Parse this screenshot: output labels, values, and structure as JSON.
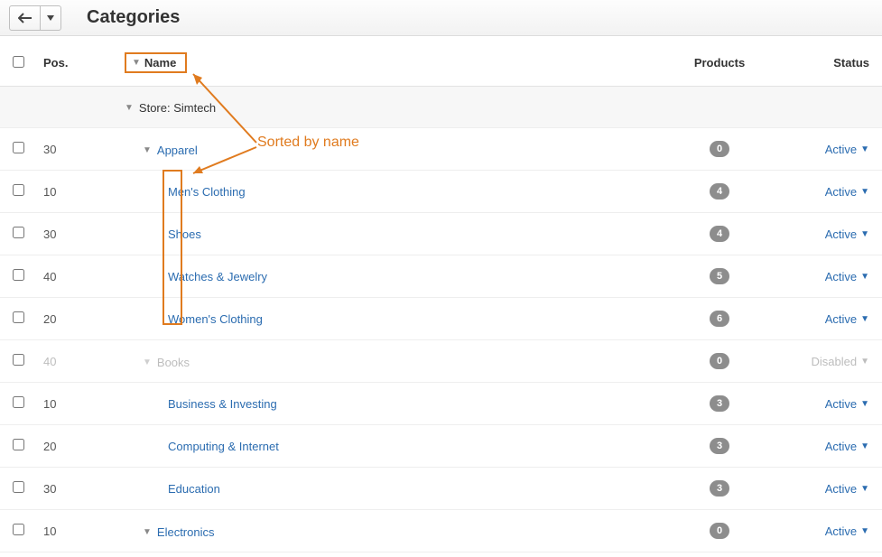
{
  "header": {
    "title": "Categories"
  },
  "columns": {
    "pos": "Pos.",
    "name": "Name",
    "products": "Products",
    "status": "Status"
  },
  "group": {
    "label": "Store: Simtech"
  },
  "rows": [
    {
      "pos": "30",
      "name": "Apparel",
      "products": "0",
      "status": "Active",
      "indent": 1,
      "expandable": true,
      "disabled": false
    },
    {
      "pos": "10",
      "name": "Men's Clothing",
      "products": "4",
      "status": "Active",
      "indent": 2,
      "expandable": false,
      "disabled": false
    },
    {
      "pos": "30",
      "name": "Shoes",
      "products": "4",
      "status": "Active",
      "indent": 2,
      "expandable": false,
      "disabled": false
    },
    {
      "pos": "40",
      "name": "Watches & Jewelry",
      "products": "5",
      "status": "Active",
      "indent": 2,
      "expandable": false,
      "disabled": false
    },
    {
      "pos": "20",
      "name": "Women's Clothing",
      "products": "6",
      "status": "Active",
      "indent": 2,
      "expandable": false,
      "disabled": false
    },
    {
      "pos": "40",
      "name": "Books",
      "products": "0",
      "status": "Disabled",
      "indent": 1,
      "expandable": true,
      "disabled": true
    },
    {
      "pos": "10",
      "name": "Business & Investing",
      "products": "3",
      "status": "Active",
      "indent": 2,
      "expandable": false,
      "disabled": false
    },
    {
      "pos": "20",
      "name": "Computing & Internet",
      "products": "3",
      "status": "Active",
      "indent": 2,
      "expandable": false,
      "disabled": false
    },
    {
      "pos": "30",
      "name": "Education",
      "products": "3",
      "status": "Active",
      "indent": 2,
      "expandable": false,
      "disabled": false
    },
    {
      "pos": "10",
      "name": "Electronics",
      "products": "0",
      "status": "Active",
      "indent": 1,
      "expandable": true,
      "disabled": false
    }
  ],
  "annotation": {
    "label": "Sorted by name"
  }
}
